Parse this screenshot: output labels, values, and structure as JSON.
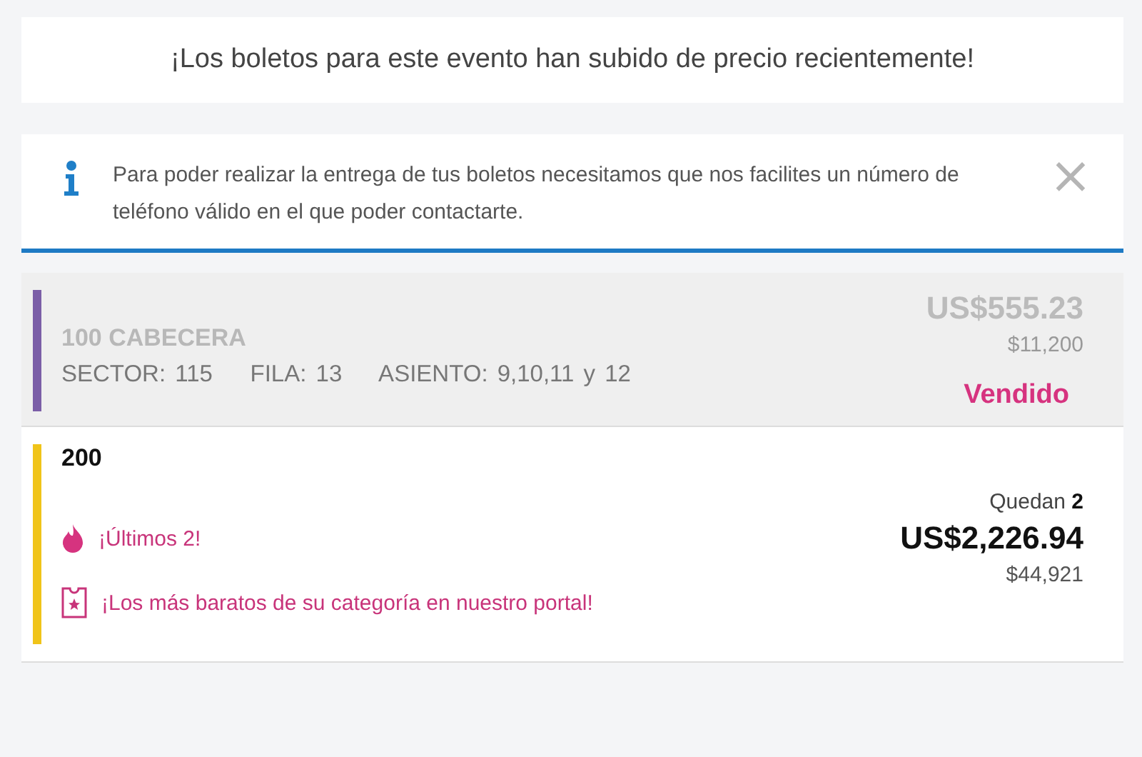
{
  "banner": {
    "text": "¡Los boletos para este evento han subido de precio recientemente!"
  },
  "notice": {
    "text": "Para poder realizar la entrega de tus boletos necesitamos que nos facilites un número de teléfono válido en el que poder contactarte.",
    "close": "×"
  },
  "listings": [
    {
      "section": "100 CABECERA",
      "details": "SECTOR: 115    FILA: 13    ASIENTO: 9,10,11 y 12",
      "price": "US$555.23",
      "local_price": "$11,200",
      "status": "Vendido",
      "sold": true,
      "color": "#7b5ea7"
    },
    {
      "section": "200",
      "remaining": "Quedan **2**",
      "price": "US$2,226.94",
      "local_price": "$44,921",
      "sold": false,
      "color": "#f0c419",
      "badges": [
        {
          "kind": "flame",
          "text": "¡Últimos 2!"
        },
        {
          "kind": "ticket",
          "text": "¡Los más baratos de su categoría en nuestro portal!"
        }
      ]
    }
  ]
}
